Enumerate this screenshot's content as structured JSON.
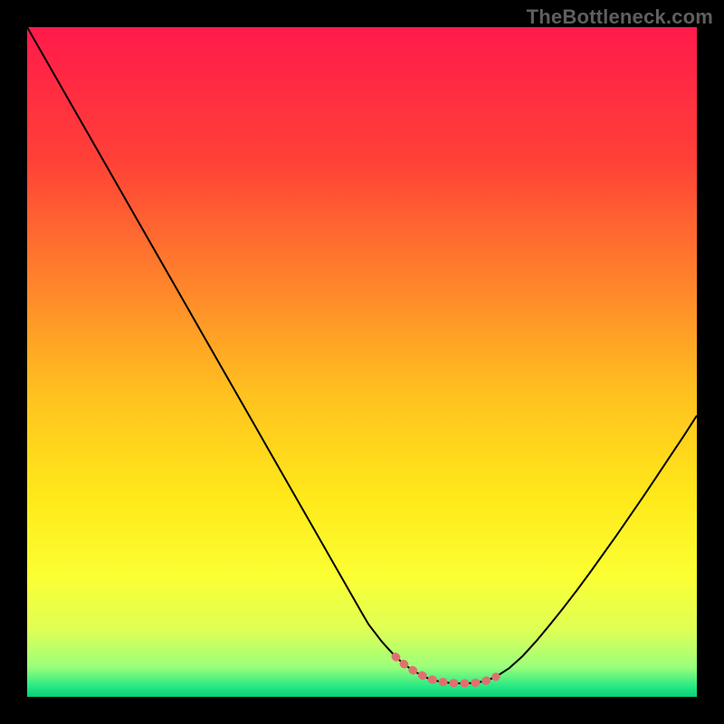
{
  "watermark": "TheBottleneck.com",
  "chart_data": {
    "type": "line",
    "title": "",
    "xlabel": "",
    "ylabel": "",
    "xlim": [
      0,
      100
    ],
    "ylim": [
      0,
      100
    ],
    "grid": false,
    "legend": null,
    "background_gradient": {
      "stops": [
        {
          "pos": 0.0,
          "color": "#ff1a4b"
        },
        {
          "pos": 0.2,
          "color": "#ff4137"
        },
        {
          "pos": 0.4,
          "color": "#ff8a2a"
        },
        {
          "pos": 0.55,
          "color": "#ffc21f"
        },
        {
          "pos": 0.7,
          "color": "#ffe81a"
        },
        {
          "pos": 0.82,
          "color": "#fbff33"
        },
        {
          "pos": 0.9,
          "color": "#dfff55"
        },
        {
          "pos": 0.955,
          "color": "#9cff7a"
        },
        {
          "pos": 0.985,
          "color": "#25e884"
        },
        {
          "pos": 1.0,
          "color": "#0acf76"
        }
      ]
    },
    "series": [
      {
        "name": "bottleneck-curve",
        "color": "#000000",
        "stroke_width": 2,
        "x": [
          0.0,
          2,
          4,
          6,
          8,
          10,
          12,
          14,
          16,
          18,
          20,
          22,
          24,
          26,
          28,
          30,
          32,
          34,
          36,
          38,
          40,
          42,
          44,
          46,
          48,
          50,
          51,
          53,
          55,
          56.5,
          58,
          60,
          61.5,
          63,
          65,
          67,
          68.5,
          70,
          72,
          74,
          76,
          78,
          80,
          82,
          84,
          86,
          88,
          90,
          92,
          94,
          96,
          98,
          100
        ],
        "y": [
          100,
          96.5,
          93,
          89.5,
          86,
          82.5,
          79,
          75.5,
          72,
          68.5,
          65,
          61.5,
          58,
          54.5,
          51,
          47.5,
          44,
          40.5,
          37,
          33.5,
          30,
          26.5,
          23,
          19.5,
          16,
          12.5,
          10.8,
          8.2,
          6.0,
          4.7,
          3.7,
          2.7,
          2.3,
          2.1,
          2.0,
          2.1,
          2.4,
          3.0,
          4.3,
          6.1,
          8.3,
          10.7,
          13.2,
          15.8,
          18.5,
          21.3,
          24.1,
          27.0,
          29.9,
          32.9,
          35.9,
          38.9,
          42.0
        ]
      },
      {
        "name": "optimal-range-marker",
        "color": "#e07070",
        "stroke_width": 9,
        "stroke_linecap": "round",
        "dash": [
          1,
          11
        ],
        "x": [
          55,
          56.5,
          58,
          60,
          61.5,
          63,
          65,
          67,
          68.5,
          70
        ],
        "y": [
          6.0,
          4.7,
          3.7,
          2.7,
          2.3,
          2.1,
          2.0,
          2.1,
          2.4,
          3.0
        ]
      }
    ]
  }
}
